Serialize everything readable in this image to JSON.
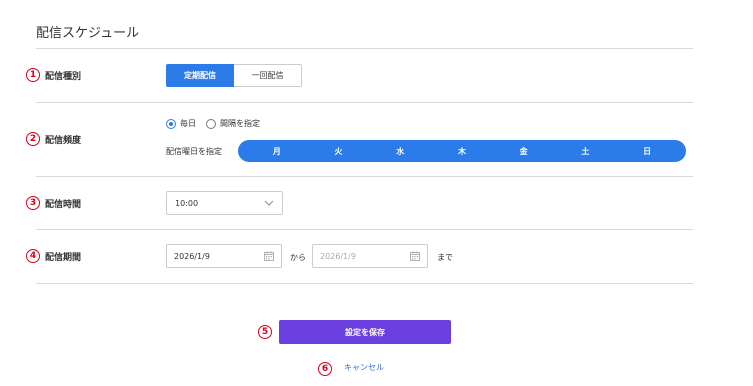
{
  "page": {
    "title": "配信スケジュール"
  },
  "rows": [
    {
      "num": "1",
      "label": "配信種別"
    },
    {
      "num": "2",
      "label": "配信頻度"
    },
    {
      "num": "3",
      "label": "配信時間"
    },
    {
      "num": "4",
      "label": "配信期間"
    }
  ],
  "delivery_type": {
    "options": [
      "定期配信",
      "一回配信"
    ],
    "selected": "定期配信"
  },
  "frequency": {
    "radios": [
      {
        "label": "毎日",
        "checked": true
      },
      {
        "label": "間隔を指定",
        "checked": false
      }
    ],
    "dow_label": "配信曜日を指定",
    "days": [
      "月",
      "火",
      "水",
      "木",
      "金",
      "土",
      "日"
    ]
  },
  "time": {
    "value": "10:00"
  },
  "period": {
    "start": "2026/1/9",
    "from_text": "から",
    "end_placeholder": "2026/1/9",
    "until_text": "まで"
  },
  "actions": {
    "save_num": "5",
    "save_label": "設定を保存",
    "cancel_num": "6",
    "cancel_label": "キャンセル"
  },
  "colors": {
    "primary": "#2b7ce9",
    "save": "#6b3fe0",
    "marker": "#d0021b",
    "link": "#2b6ed9"
  }
}
